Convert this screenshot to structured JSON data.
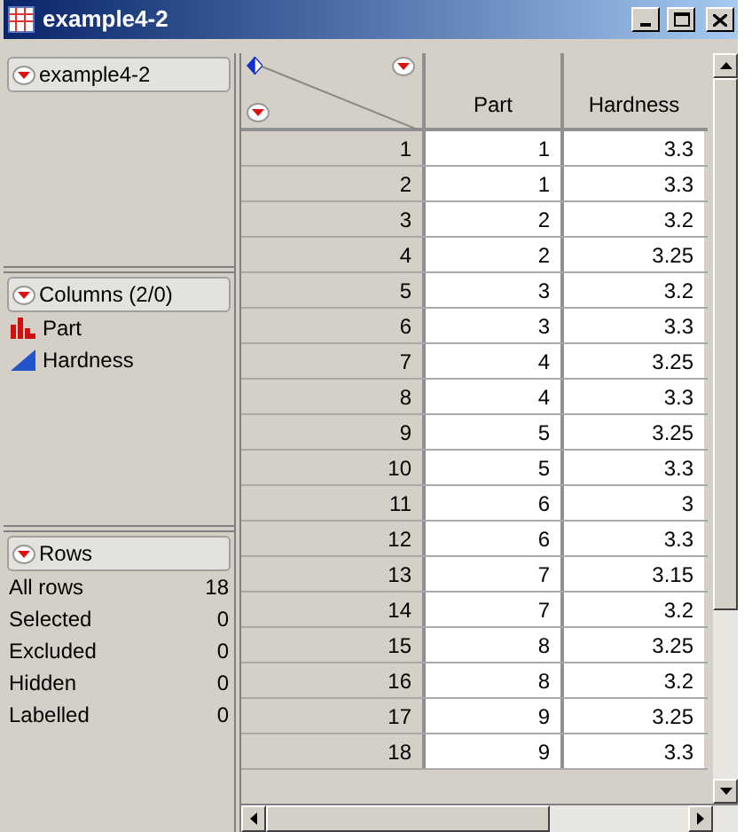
{
  "window": {
    "title": "example4-2"
  },
  "table_panel": {
    "name": "example4-2"
  },
  "columns_panel": {
    "title": "Columns (2/0)",
    "items": [
      {
        "name": "Part",
        "kind": "nominal"
      },
      {
        "name": "Hardness",
        "kind": "continuous"
      }
    ]
  },
  "rows_panel": {
    "title": "Rows",
    "items": [
      {
        "label": "All rows",
        "value": "18"
      },
      {
        "label": "Selected",
        "value": "0"
      },
      {
        "label": "Excluded",
        "value": "0"
      },
      {
        "label": "Hidden",
        "value": "0"
      },
      {
        "label": "Labelled",
        "value": "0"
      }
    ]
  },
  "table": {
    "columns": [
      "Part",
      "Hardness"
    ],
    "rows": [
      [
        "1",
        "1",
        "3.3"
      ],
      [
        "2",
        "1",
        "3.3"
      ],
      [
        "3",
        "2",
        "3.2"
      ],
      [
        "4",
        "2",
        "3.25"
      ],
      [
        "5",
        "3",
        "3.2"
      ],
      [
        "6",
        "3",
        "3.3"
      ],
      [
        "7",
        "4",
        "3.25"
      ],
      [
        "8",
        "4",
        "3.3"
      ],
      [
        "9",
        "5",
        "3.25"
      ],
      [
        "10",
        "5",
        "3.3"
      ],
      [
        "11",
        "6",
        "3"
      ],
      [
        "12",
        "6",
        "3.3"
      ],
      [
        "13",
        "7",
        "3.15"
      ],
      [
        "14",
        "7",
        "3.2"
      ],
      [
        "15",
        "8",
        "3.25"
      ],
      [
        "16",
        "8",
        "3.2"
      ],
      [
        "17",
        "9",
        "3.25"
      ],
      [
        "18",
        "9",
        "3.3"
      ]
    ]
  }
}
